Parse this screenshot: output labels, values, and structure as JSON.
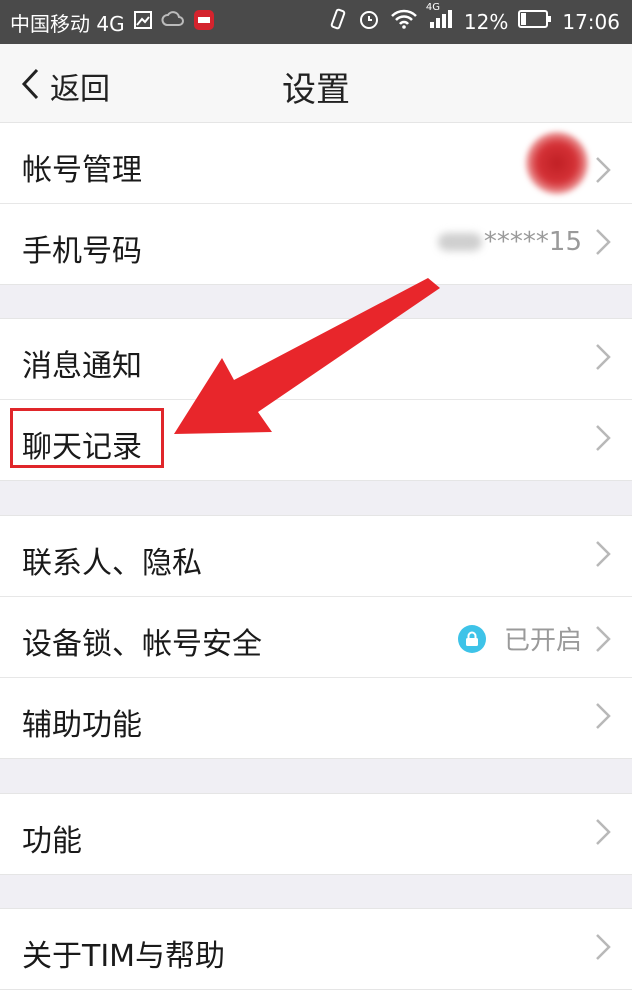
{
  "status_bar": {
    "carrier": "中国移动 4G",
    "network": "4G",
    "battery": "12%",
    "time": "17:06"
  },
  "nav": {
    "back_label": "返回",
    "title": "设置"
  },
  "groups": [
    {
      "rows": [
        {
          "label": "帐号管理",
          "value": ""
        },
        {
          "label": "手机号码",
          "value": "*****15"
        }
      ]
    },
    {
      "rows": [
        {
          "label": "消息通知",
          "value": ""
        },
        {
          "label": "聊天记录",
          "value": ""
        }
      ]
    },
    {
      "rows": [
        {
          "label": "联系人、隐私",
          "value": ""
        },
        {
          "label": "设备锁、帐号安全",
          "value": "已开启"
        },
        {
          "label": "辅助功能",
          "value": ""
        }
      ]
    },
    {
      "rows": [
        {
          "label": "功能",
          "value": ""
        }
      ]
    },
    {
      "rows": [
        {
          "label": "关于TIM与帮助",
          "value": ""
        }
      ]
    }
  ],
  "colors": {
    "annotation": "#e0262a",
    "lock_badge": "#3ec3e8",
    "status_bar_bg": "#4a4a4a"
  }
}
